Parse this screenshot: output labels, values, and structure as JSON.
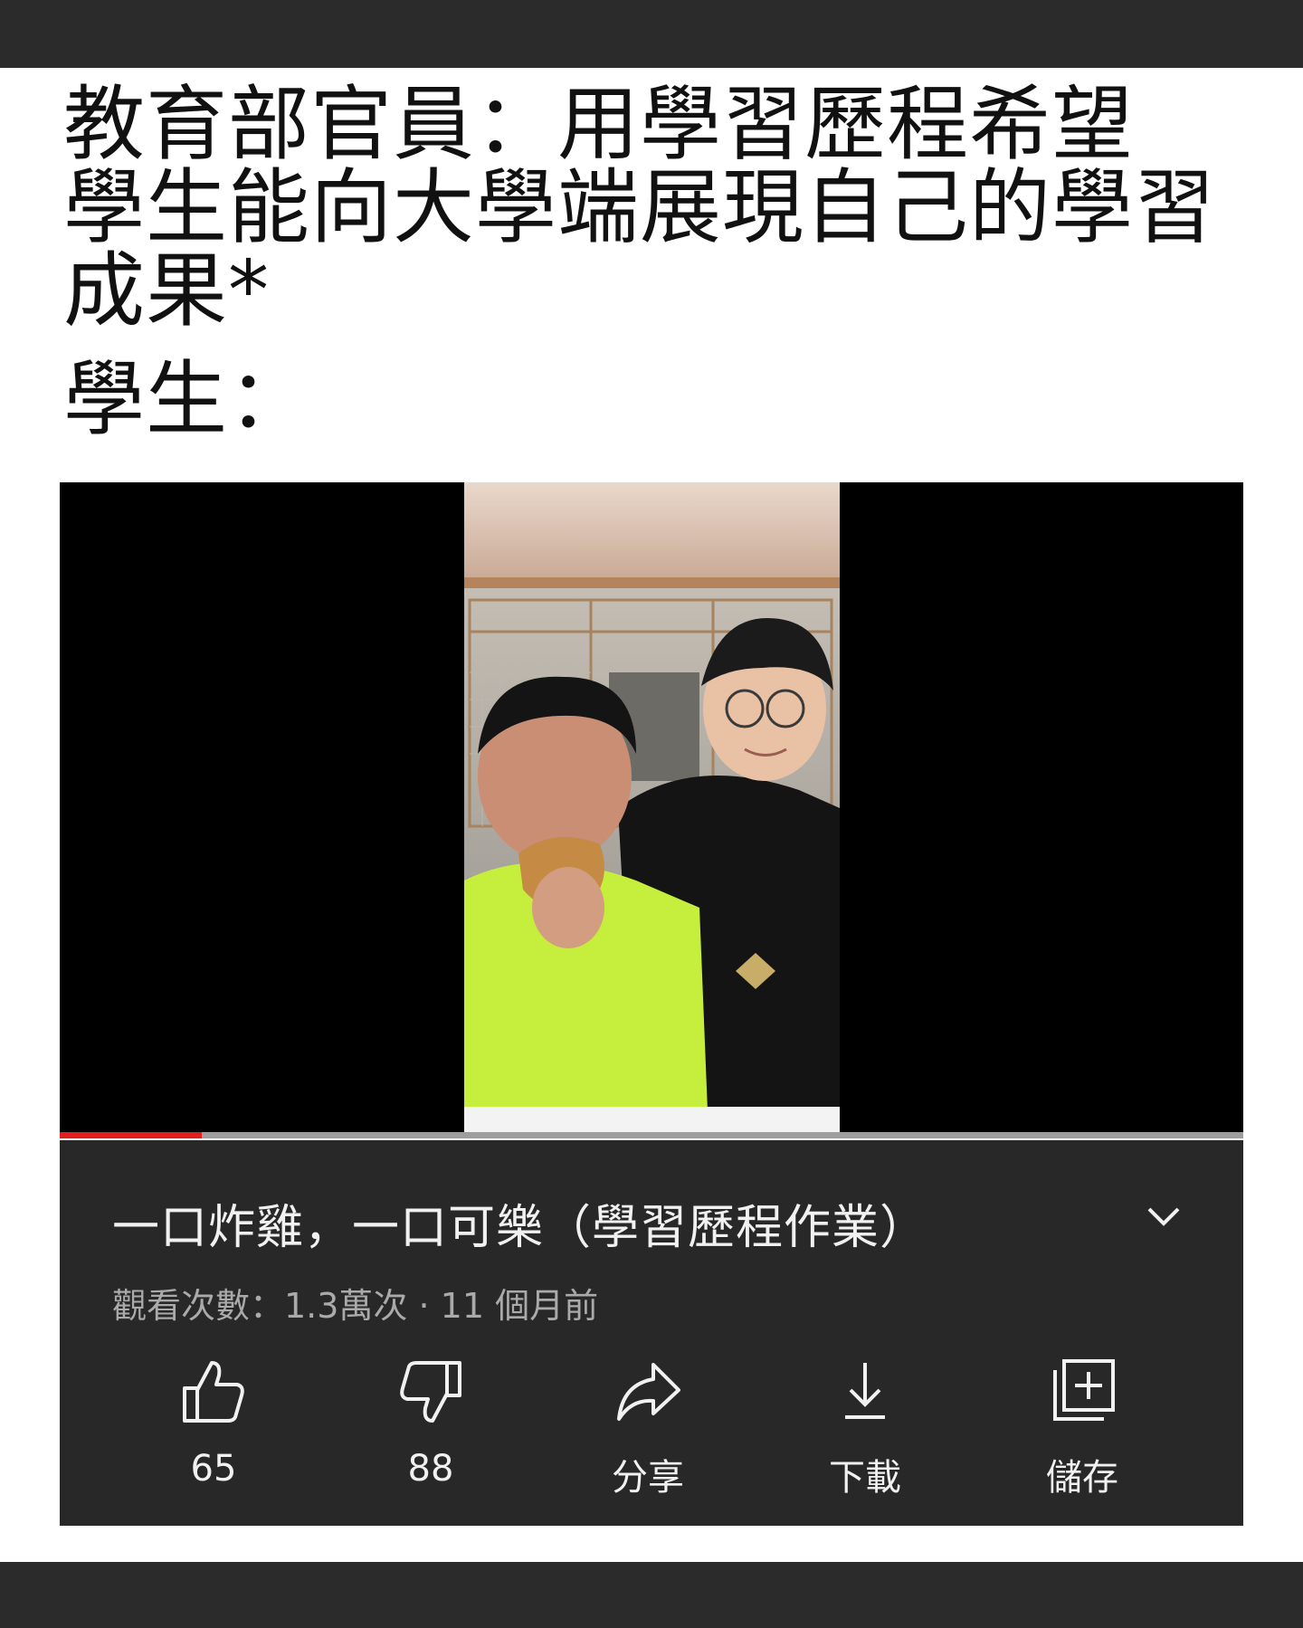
{
  "meme": {
    "caption_lines": [
      "教育部官員：用學習歷程希望",
      "學生能向大學端展現自己的學習",
      "成果*"
    ],
    "student_line": "學生："
  },
  "video": {
    "progress_fraction": 0.12,
    "title": "一口炸雞，一口可樂（學習歷程作業）",
    "meta": "觀看次數：1.3萬次 · 11 個月前",
    "actions": [
      {
        "icon": "thumbs-up-icon",
        "label": "65"
      },
      {
        "icon": "thumbs-down-icon",
        "label": "88"
      },
      {
        "icon": "share-icon",
        "label": "分享"
      },
      {
        "icon": "download-icon",
        "label": "下載"
      },
      {
        "icon": "save-to-playlist-icon",
        "label": "儲存"
      }
    ]
  },
  "colors": {
    "progress": "#e01e1e",
    "panel": "#282828",
    "text_primary": "#f1f1f1",
    "text_secondary": "#aaaaaa"
  }
}
